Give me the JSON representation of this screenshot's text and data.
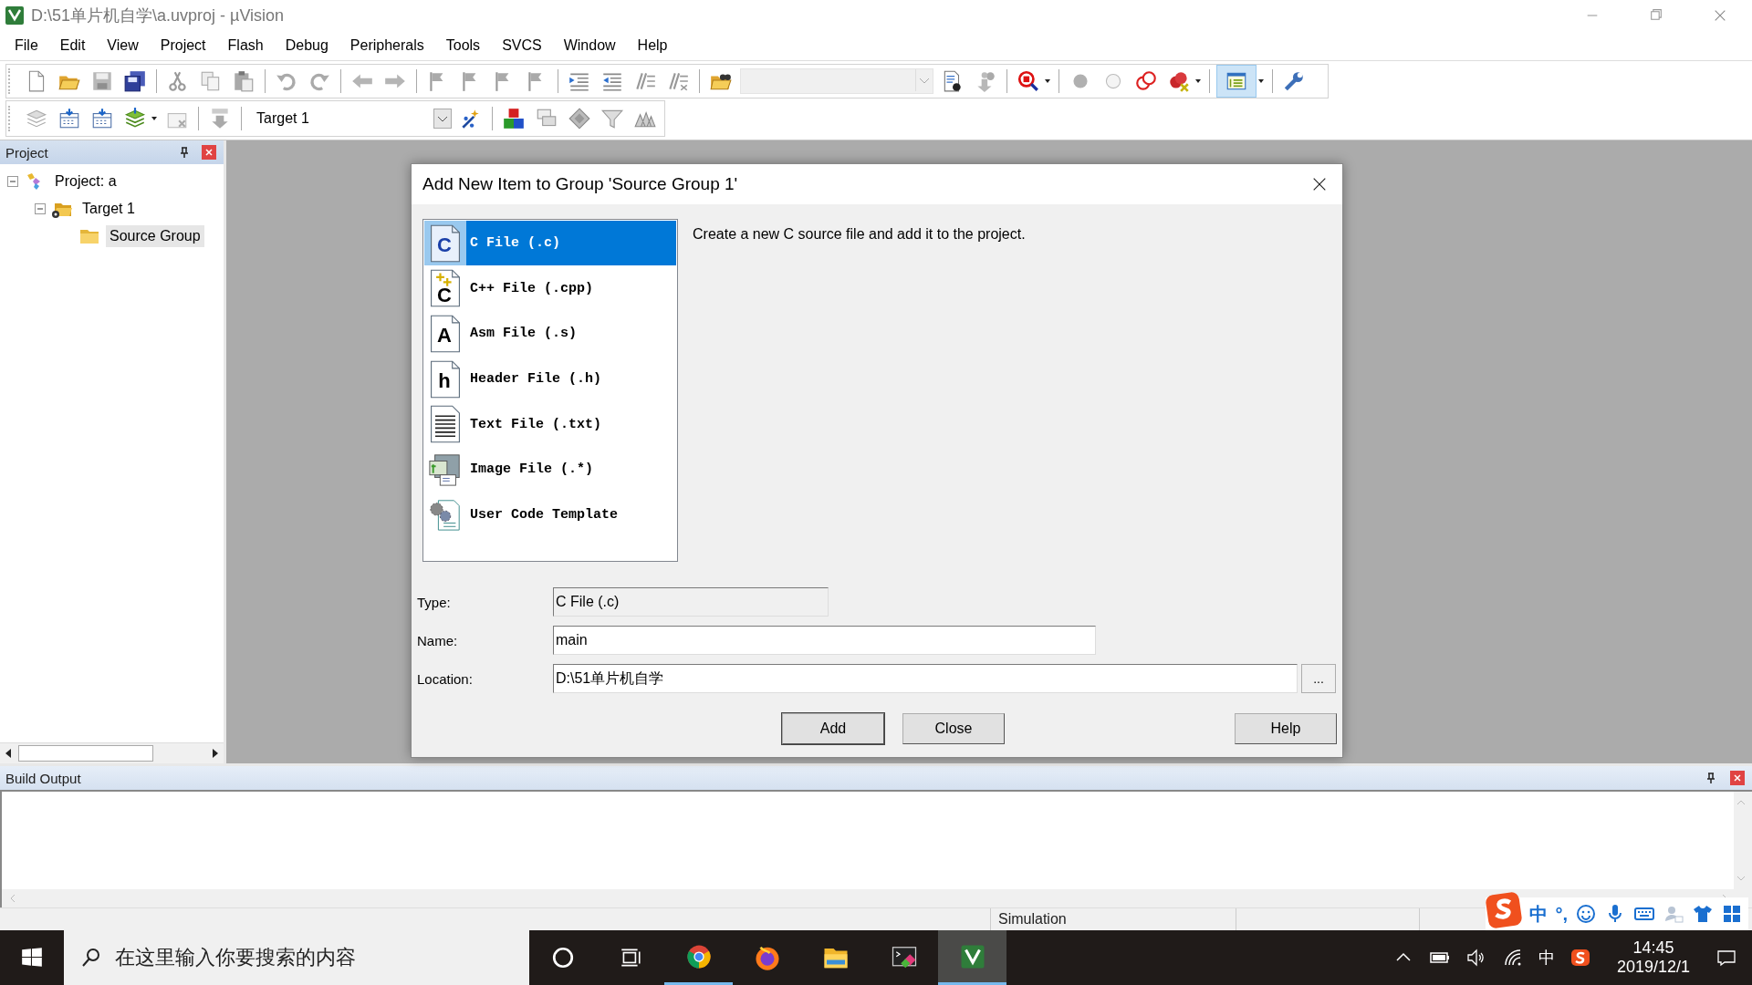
{
  "window": {
    "title": "D:\\51单片机自学\\a.uvproj - µVision"
  },
  "menu": [
    "File",
    "Edit",
    "View",
    "Project",
    "Flash",
    "Debug",
    "Peripherals",
    "Tools",
    "SVCS",
    "Window",
    "Help"
  ],
  "toolbar": {
    "target": "Target 1"
  },
  "project_panel": {
    "title": "Project",
    "tree": [
      {
        "kind": "project",
        "label": "Project: a",
        "expanded": true,
        "selected": false,
        "children": [
          {
            "kind": "target",
            "label": "Target 1",
            "expanded": true,
            "selected": false,
            "children": [
              {
                "kind": "group",
                "label": "Source Group",
                "selected": true
              }
            ]
          }
        ]
      }
    ]
  },
  "dialog": {
    "title": "Add New Item to Group 'Source Group 1'",
    "items": [
      {
        "kind": "c",
        "glyph": "C",
        "label": "C File (.c)",
        "selected": true
      },
      {
        "kind": "cpp",
        "glyph": "C",
        "label": "C++ File (.cpp)",
        "selected": false
      },
      {
        "kind": "asm",
        "glyph": "A",
        "label": "Asm File (.s)",
        "selected": false
      },
      {
        "kind": "header",
        "glyph": "h",
        "label": "Header File (.h)",
        "selected": false
      },
      {
        "kind": "text",
        "label": "Text File (.txt)",
        "selected": false
      },
      {
        "kind": "image",
        "label": "Image File (.*)",
        "selected": false
      },
      {
        "kind": "template",
        "label": "User Code Template",
        "selected": false
      }
    ],
    "description": "Create a new C source file and add it to the project.",
    "type_label": "Type:",
    "type_value": "C File (.c)",
    "name_label": "Name:",
    "name_value": "main",
    "location_label": "Location:",
    "location_value": "D:\\51单片机自学",
    "browse": "...",
    "buttons": [
      "Add",
      "Close"
    ],
    "help": "Help"
  },
  "build_output": {
    "title": "Build Output"
  },
  "status_bar": {
    "mode": "Simulation"
  },
  "ime_bar": {
    "lang": "中",
    "punct": "°,"
  },
  "taskbar": {
    "search_placeholder": "在这里输入你要搜索的内容",
    "apps": [
      {
        "kind": "chrome",
        "running": true,
        "active": false
      },
      {
        "kind": "firefox",
        "running": false,
        "active": false
      },
      {
        "kind": "explorer",
        "running": false,
        "active": false
      },
      {
        "kind": "terminal",
        "running": false,
        "active": false
      },
      {
        "kind": "uvision",
        "running": true,
        "active": true
      }
    ],
    "tray_lang": "中",
    "time": "14:45",
    "date": "2019/12/1"
  }
}
